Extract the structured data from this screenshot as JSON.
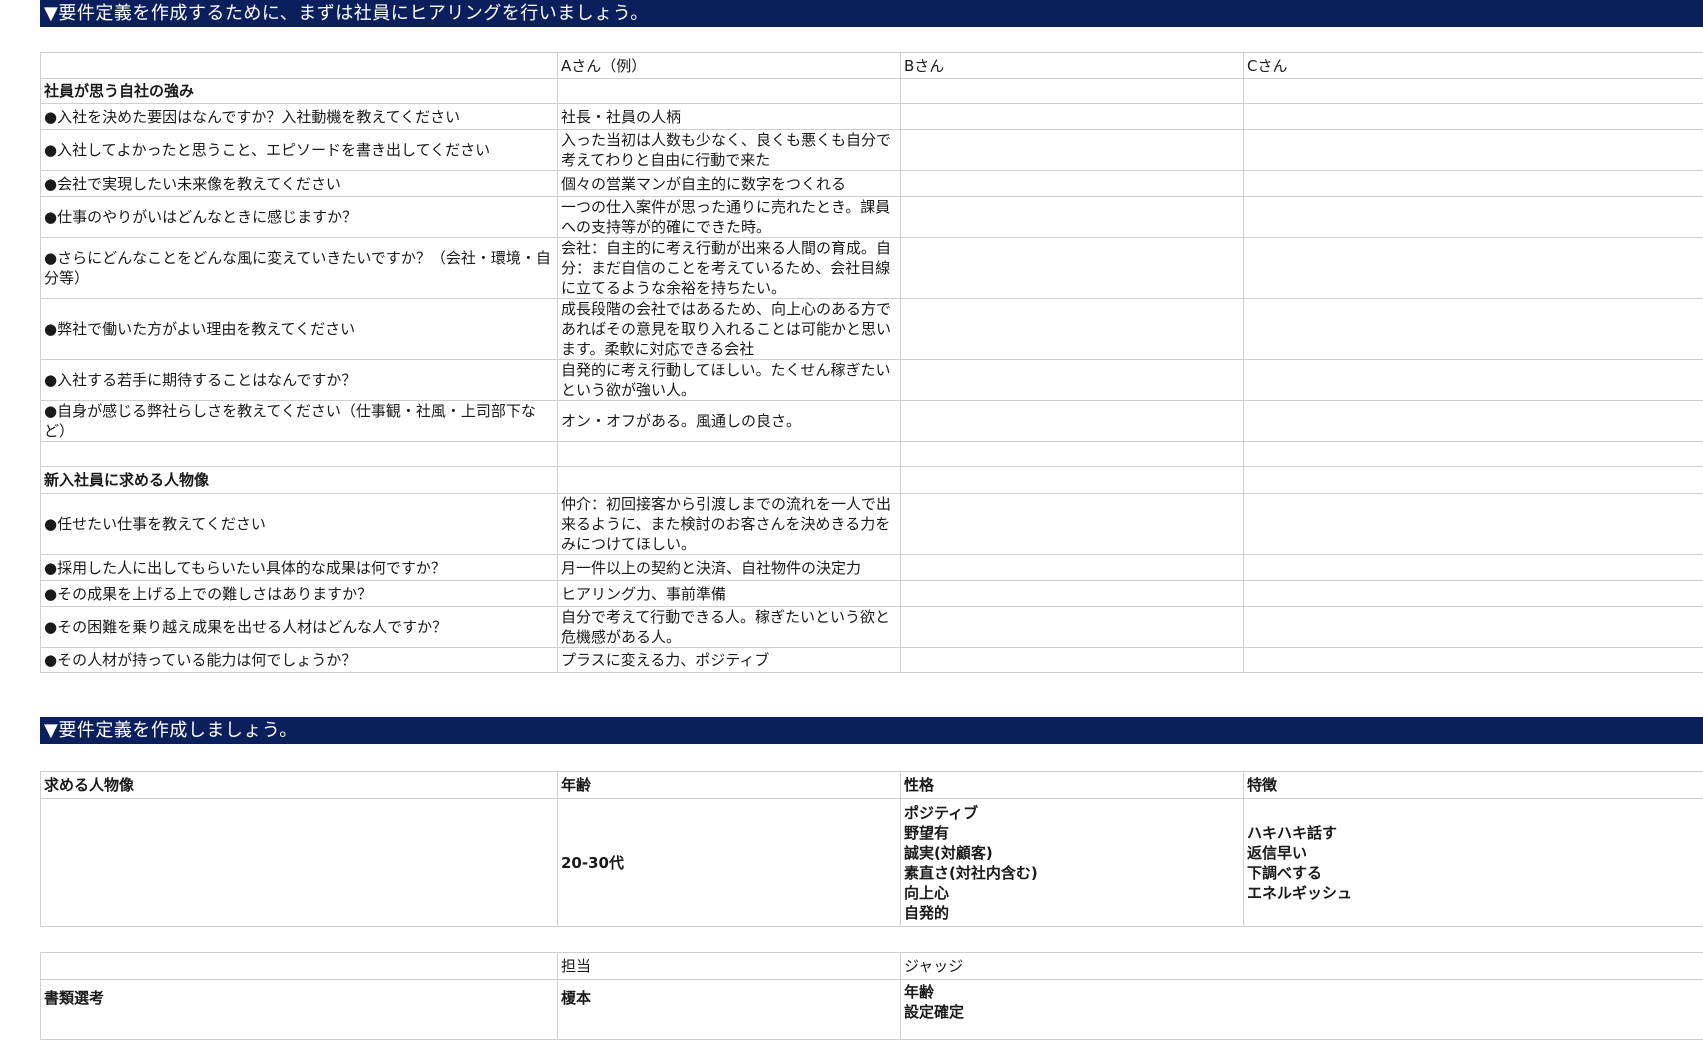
{
  "banner1": "▼要件定義を作成するために、まずは社員にヒアリングを行いましょう。",
  "hearing": {
    "header": [
      "",
      "Aさん（例）",
      "Bさん",
      "Cさん"
    ],
    "section1_title": "社員が思う自社の強み",
    "section1_rows": [
      {
        "q": "●入社を決めた要因はなんですか？入社動機を教えてください",
        "a": "社長・社員の人柄"
      },
      {
        "q": "●入社してよかったと思うこと、エピソードを書き出してください",
        "a": "入った当初は人数も少なく、良くも悪くも自分で考えてわりと自由に行動で来た"
      },
      {
        "q": "●会社で実現したい未来像を教えてください",
        "a": "個々の営業マンが自主的に数字をつくれる"
      },
      {
        "q": "●仕事のやりがいはどんなときに感じますか？",
        "a": "一つの仕入案件が思った通りに売れたとき。課員への支持等が的確にできた時。"
      },
      {
        "q": "●さらにどんなことをどんな風に変えていきたいですか？（会社・環境・自分等）",
        "a": "会社：自主的に考え行動が出来る人間の育成。自分：まだ自信のことを考えているため、会社目線に立てるような余裕を持ちたい。"
      },
      {
        "q": "●弊社で働いた方がよい理由を教えてください",
        "a": "成長段階の会社ではあるため、向上心のある方であればその意見を取り入れることは可能かと思います。柔軟に対応できる会社"
      },
      {
        "q": "●入社する若手に期待することはなんですか？",
        "a": "自発的に考え行動してほしい。たくせん稼ぎたいという欲が強い人。"
      },
      {
        "q": "●自身が感じる弊社らしさを教えてください（仕事観・社風・上司部下など）",
        "a": "オン・オフがある。風通しの良さ。"
      }
    ],
    "section2_title": "新入社員に求める人物像",
    "section2_rows": [
      {
        "q": "●任せたい仕事を教えてください",
        "a": "仲介：初回接客から引渡しまでの流れを一人で出来るように、また検討のお客さんを決めきる力をみにつけてほしい。"
      },
      {
        "q": "●採用した人に出してもらいたい具体的な成果は何ですか？",
        "a": "月一件以上の契約と決済、自社物件の決定力"
      },
      {
        "q": "●その成果を上げる上での難しさはありますか？",
        "a": "ヒアリング力、事前準備"
      },
      {
        "q": "●その困難を乗り越え成果を出せる人材はどんな人ですか？",
        "a": "自分で考えて行動できる人。稼ぎたいという欲と危機感がある人。"
      },
      {
        "q": "●その人材が持っている能力は何でしょうか？",
        "a": "プラスに変える力、ポジティブ"
      }
    ]
  },
  "banner2": "▼要件定義を作成しましょう。",
  "requirements": {
    "headers": [
      "求める人物像",
      "年齢",
      "性格",
      "特徴"
    ],
    "age": "20-30代",
    "personality": "ポジティブ\n野望有\n誠実(対顧客)\n素直さ(対社内含む)\n向上心\n自発的",
    "features": "ハキハキ話す\n返信早い\n下調べする\nエネルギッシュ"
  },
  "selection": {
    "headers": [
      "",
      "担当",
      "ジャッジ"
    ],
    "row_label": "書類選考",
    "person": "榎本",
    "judge": "年齢\n設定確定"
  }
}
